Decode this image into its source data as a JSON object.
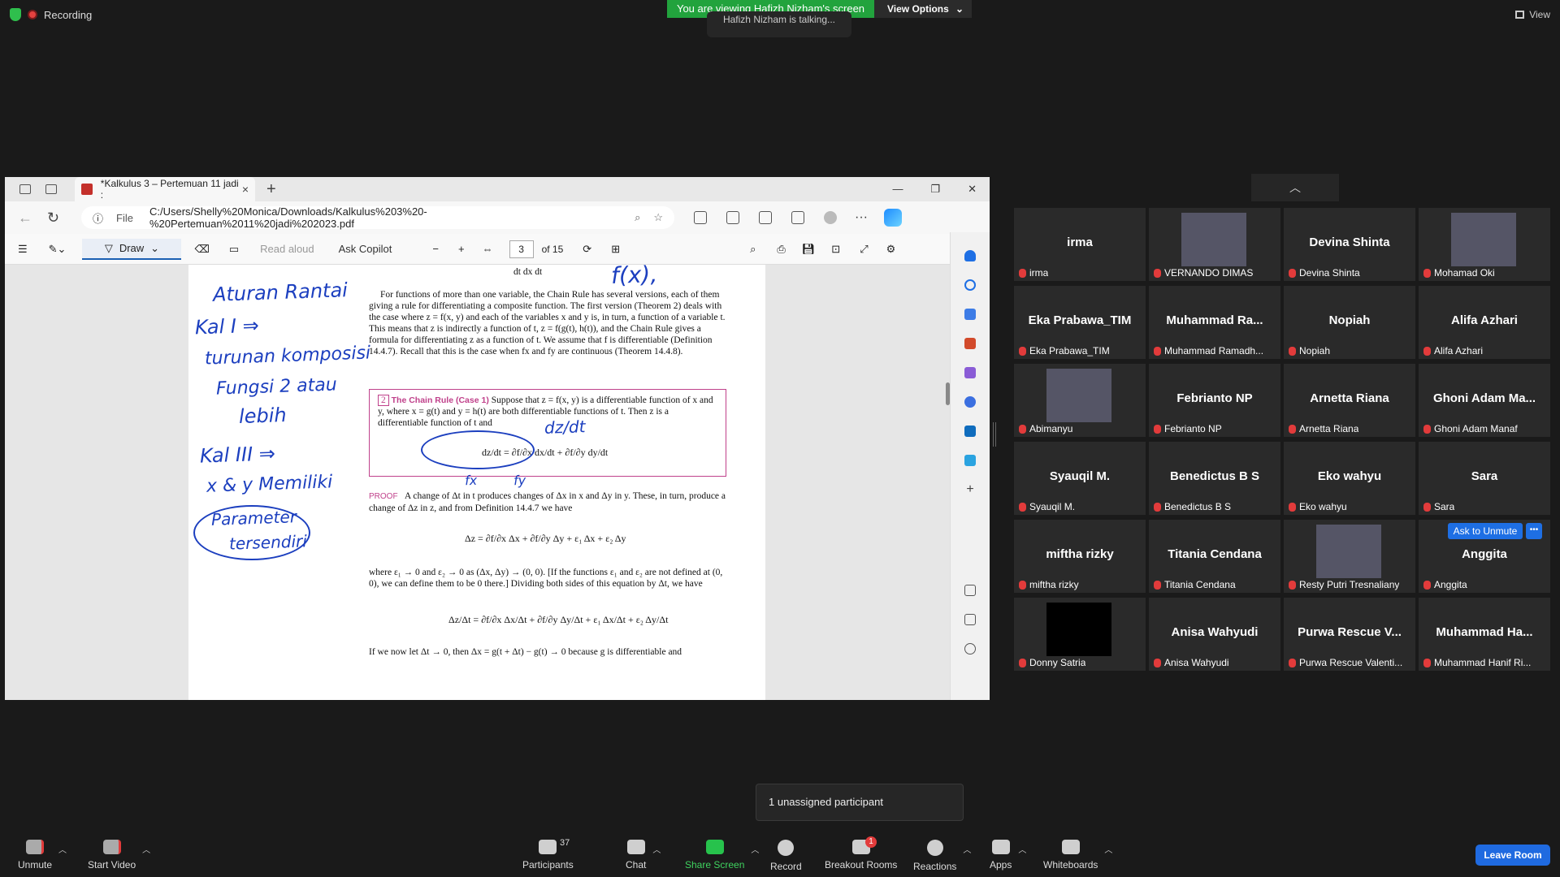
{
  "top": {
    "recording": "Recording",
    "viewing_banner": "You are viewing Hafizh Nizham's screen",
    "view_options": "View Options",
    "talking": "Hafizh Nizham is talking...",
    "view_label": "View"
  },
  "browser": {
    "tab_title": "*Kalkulus 3 – Pertemuan 11 jadi :",
    "file_label": "File",
    "url": "C:/Users/Shelly%20Monica/Downloads/Kalkulus%203%20-%20Pertemuan%2011%20jadi%202023.pdf",
    "toolbar": {
      "draw": "Draw",
      "read_aloud": "Read aloud",
      "ask_copilot": "Ask Copilot",
      "page_number": "3",
      "of_pages": "of 15"
    }
  },
  "pdf": {
    "para1": "For functions of more than one variable, the Chain Rule has several versions, each of them giving a rule for differentiating a composite function. The first version (Theorem 2) deals with the case where z = f(x, y) and each of the variables x and y is, in turn, a function of a variable t. This means that z is indirectly a function of t, z = f(g(t), h(t)), and the Chain Rule gives a formula for differentiating z as a function of t. We assume that f is differentiable (Definition 14.4.7). Recall that this is the case when fx and fy are continuous (Theorem 14.4.8).",
    "theorem_num": "2",
    "theorem_title": "The Chain Rule (Case 1)",
    "theorem_text": "Suppose that z = f(x, y) is a differentiable function of x and y, where x = g(t) and y = h(t) are both differentiable functions of t. Then z is a differentiable function of t and",
    "theorem_formula": "dz/dt = ∂f/∂x dx/dt + ∂f/∂y dy/dt",
    "proof_label": "PROOF",
    "proof_text": "A change of Δt in t produces changes of Δx in x and Δy in y. These, in turn, produce a change of Δz in z, and from Definition 14.4.7 we have",
    "formula2": "Δz = ∂f/∂x Δx + ∂f/∂y Δy + ε₁ Δx + ε₂ Δy",
    "para3": "where ε₁ → 0 and ε₂ → 0 as (Δx, Δy) → (0, 0). [If the functions ε₁ and ε₂ are not defined at (0, 0), we can define them to be 0 there.] Dividing both sides of this equation by Δt, we have",
    "formula3": "Δz/Δt = ∂f/∂x Δx/Δt + ∂f/∂y Δy/Δt + ε₁ Δx/Δt + ε₂ Δy/Δt",
    "para4": "If we now let Δt → 0, then Δx = g(t + Δt) − g(t) → 0 because g is differentiable and",
    "top_formula": "dt   dx  dt",
    "top_hand": "f(x),",
    "hand": {
      "h1": "Aturan Rantai",
      "h2": "Kal I ⇒",
      "h3": "turunan komposisi",
      "h4": "Fungsi 2 atau",
      "h5": "lebih",
      "h6": "Kal III ⇒",
      "h7": "x & y Memiliki",
      "h8": "Parameter",
      "h9": "tersendiri",
      "h10": "dz/dt",
      "h11": "fx",
      "h12": "fy"
    }
  },
  "participants": [
    {
      "display": "irma",
      "label": "irma"
    },
    {
      "display": "",
      "label": "VERNANDO DIMAS",
      "photo": true
    },
    {
      "display": "Devina Shinta",
      "label": "Devina Shinta"
    },
    {
      "display": "",
      "label": "Mohamad Oki",
      "photo": true
    },
    {
      "display": "Eka Prabawa_TIM",
      "label": "Eka Prabawa_TIM"
    },
    {
      "display": "Muhammad  Ra...",
      "label": "Muhammad Ramadh..."
    },
    {
      "display": "Nopiah",
      "label": "Nopiah"
    },
    {
      "display": "Alifa Azhari",
      "label": "Alifa Azhari"
    },
    {
      "display": "",
      "label": "Abimanyu",
      "photo": true
    },
    {
      "display": "Febrianto NP",
      "label": "Febrianto NP"
    },
    {
      "display": "Arnetta Riana",
      "label": "Arnetta Riana"
    },
    {
      "display": "Ghoni  Adam  Ma...",
      "label": "Ghoni Adam Manaf"
    },
    {
      "display": "Syauqil M.",
      "label": "Syauqil M."
    },
    {
      "display": "Benedictus B S",
      "label": "Benedictus B S"
    },
    {
      "display": "Eko wahyu",
      "label": "Eko wahyu"
    },
    {
      "display": "Sara",
      "label": "Sara"
    },
    {
      "display": "miftha rizky",
      "label": "miftha rizky"
    },
    {
      "display": "Titania Cendana",
      "label": "Titania Cendana"
    },
    {
      "display": "",
      "label": "Resty Putri Tresnaliany",
      "photo": true
    },
    {
      "display": "Anggita",
      "label": "Anggita"
    },
    {
      "display": "",
      "label": "Donny Satria",
      "photo": true
    },
    {
      "display": "Anisa Wahyudi",
      "label": "Anisa Wahyudi"
    },
    {
      "display": "Purwa Rescue V...",
      "label": "Purwa Rescue Valenti..."
    },
    {
      "display": "Muhammad  Ha...",
      "label": "Muhammad Hanif Ri..."
    }
  ],
  "ask_to_unmute": "Ask to Unmute",
  "more": "•••",
  "unassigned": "1 unassigned participant",
  "bottom": {
    "unmute": "Unmute",
    "start_video": "Start Video",
    "participants": "Participants",
    "participants_count": "37",
    "chat": "Chat",
    "share_screen": "Share Screen",
    "record": "Record",
    "breakout_rooms": "Breakout Rooms",
    "breakout_badge": "1",
    "reactions": "Reactions",
    "apps": "Apps",
    "whiteboards": "Whiteboards",
    "leave_room": "Leave Room"
  }
}
